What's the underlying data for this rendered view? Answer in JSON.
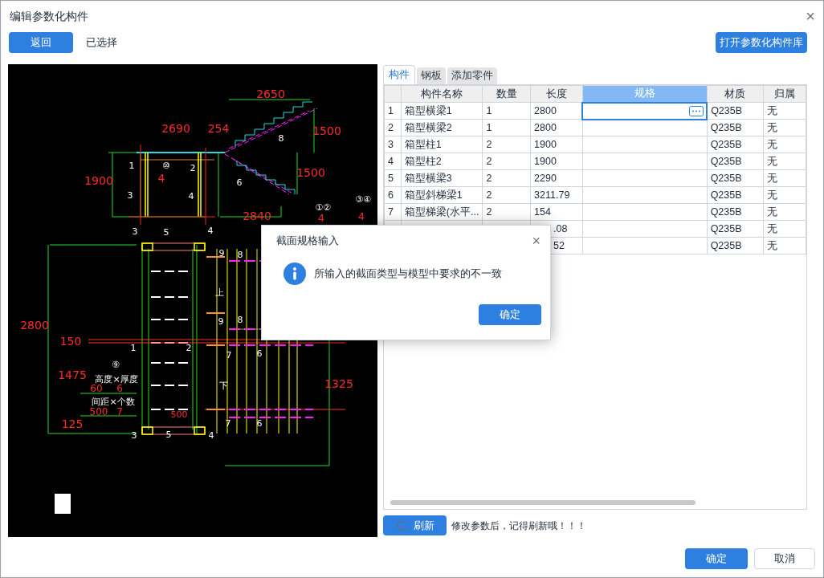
{
  "window": {
    "title": "编辑参数化构件",
    "close": "×"
  },
  "toolbar": {
    "back": "返回",
    "selected_label": "已选择",
    "open_library": "打开参数化构件库"
  },
  "drawing_labels": [
    {
      "text": "2650",
      "kind": "dim"
    },
    {
      "text": "2690",
      "kind": "dim"
    },
    {
      "text": "254",
      "kind": "dim"
    },
    {
      "text": "1500",
      "kind": "dim"
    },
    {
      "text": "1500",
      "kind": "dim"
    },
    {
      "text": "1900",
      "kind": "dim"
    },
    {
      "text": "4",
      "kind": "dim"
    },
    {
      "text": "1",
      "kind": "tag"
    },
    {
      "text": "⑩",
      "kind": "tag"
    },
    {
      "text": "2",
      "kind": "tag"
    },
    {
      "text": "3",
      "kind": "tag"
    },
    {
      "text": "4",
      "kind": "tag"
    },
    {
      "text": "8",
      "kind": "tag"
    },
    {
      "text": "6",
      "kind": "tag"
    },
    {
      "text": "①②",
      "kind": "tag"
    },
    {
      "text": "③④",
      "kind": "tag"
    },
    {
      "text": "2840",
      "kind": "dim"
    },
    {
      "text": "4",
      "kind": "dim"
    },
    {
      "text": "4",
      "kind": "dim"
    },
    {
      "text": "3",
      "kind": "tag"
    },
    {
      "text": "5",
      "kind": "tag"
    },
    {
      "text": "4",
      "kind": "tag"
    },
    {
      "text": "9",
      "kind": "tag"
    },
    {
      "text": "8",
      "kind": "tag"
    },
    {
      "text": "上",
      "kind": "tag"
    },
    {
      "text": "9",
      "kind": "tag"
    },
    {
      "text": "8",
      "kind": "tag"
    },
    {
      "text": "2800",
      "kind": "dim"
    },
    {
      "text": "150",
      "kind": "dim"
    },
    {
      "text": "1",
      "kind": "tag"
    },
    {
      "text": "2",
      "kind": "tag"
    },
    {
      "text": "7",
      "kind": "tag"
    },
    {
      "text": "6",
      "kind": "tag"
    },
    {
      "text": "⑨",
      "kind": "tag"
    },
    {
      "text": "1475",
      "kind": "dim"
    },
    {
      "text": "高度×厚度",
      "kind": "tag"
    },
    {
      "text": "60",
      "kind": "dim"
    },
    {
      "text": "6",
      "kind": "dim"
    },
    {
      "text": "间距×个数",
      "kind": "tag"
    },
    {
      "text": "500",
      "kind": "dim"
    },
    {
      "text": "7",
      "kind": "dim"
    },
    {
      "text": "下",
      "kind": "tag"
    },
    {
      "text": "1325",
      "kind": "dim"
    },
    {
      "text": "500",
      "kind": "dim"
    },
    {
      "text": "125",
      "kind": "dim"
    },
    {
      "text": "7",
      "kind": "tag"
    },
    {
      "text": "6",
      "kind": "tag"
    },
    {
      "text": "3",
      "kind": "tag"
    },
    {
      "text": "5",
      "kind": "tag"
    },
    {
      "text": "4",
      "kind": "tag"
    }
  ],
  "tabs": [
    {
      "label": "构件",
      "selected": true
    },
    {
      "label": "钢板",
      "selected": false
    },
    {
      "label": "添加零件",
      "selected": false
    }
  ],
  "table": {
    "columns": [
      {
        "label": "构件名称",
        "selected": false
      },
      {
        "label": "数量",
        "selected": false
      },
      {
        "label": "长度",
        "selected": false
      },
      {
        "label": "规格",
        "selected": true
      },
      {
        "label": "材质",
        "selected": false
      },
      {
        "label": "归属",
        "selected": false
      }
    ],
    "rows": [
      {
        "kind": "full",
        "index": "1",
        "name": "箱型横梁1",
        "qty": "1",
        "length": "2800",
        "material": "Q235B",
        "owner": "无",
        "editing": true
      },
      {
        "kind": "full",
        "index": "2",
        "name": "箱型横梁2",
        "qty": "1",
        "length": "2800",
        "material": "Q235B",
        "owner": "无",
        "editing": false
      },
      {
        "kind": "full",
        "index": "3",
        "name": "箱型柱1",
        "qty": "2",
        "length": "1900",
        "material": "Q235B",
        "owner": "无",
        "editing": false
      },
      {
        "kind": "full",
        "index": "4",
        "name": "箱型柱2",
        "qty": "2",
        "length": "1900",
        "material": "Q235B",
        "owner": "无",
        "editing": false
      },
      {
        "kind": "full",
        "index": "5",
        "name": "箱型横梁3",
        "qty": "2",
        "length": "2290",
        "material": "Q235B",
        "owner": "无",
        "editing": false
      },
      {
        "kind": "full",
        "index": "6",
        "name": "箱型斜梯梁1",
        "qty": "2",
        "length": "3211.79",
        "material": "Q235B",
        "owner": "无",
        "editing": false
      },
      {
        "kind": "full",
        "index": "7",
        "name": "箱型梯梁(水平...",
        "qty": "2",
        "length": "154",
        "material": "Q235B",
        "owner": "无",
        "editing": false
      },
      {
        "kind": "covered",
        "length": ".08",
        "material": "Q235B",
        "owner": "无",
        "editing": false
      },
      {
        "kind": "covered",
        "length": "52",
        "material": "Q235B",
        "owner": "无",
        "editing": false
      }
    ]
  },
  "refresh": {
    "label": "刷新",
    "hint": "修改参数后，记得刷新哦！！！"
  },
  "footer": {
    "ok": "确定",
    "cancel": "取消"
  },
  "dialog": {
    "title": "截面规格输入",
    "close": "×",
    "message": "所输入的截面类型与模型中要求的不一致",
    "ok": "确定"
  }
}
